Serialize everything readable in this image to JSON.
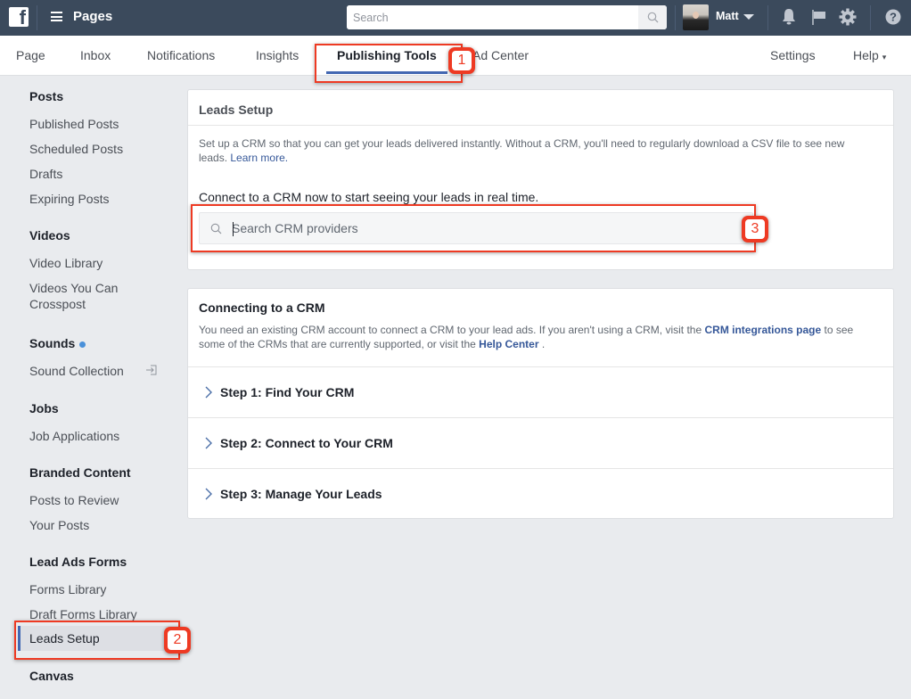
{
  "topbar": {
    "brand_icon": "facebook-logo",
    "menu_icon": "hamburger-icon",
    "app_title": "Pages",
    "search_placeholder": "Search",
    "search_icon": "search-icon",
    "user_name": "Matt",
    "icons": [
      "bell-icon",
      "flag-icon",
      "gear-icon",
      "help-icon"
    ]
  },
  "nav": {
    "tabs": [
      {
        "label": "Page"
      },
      {
        "label": "Inbox"
      },
      {
        "label": "Notifications"
      },
      {
        "label": "Insights"
      },
      {
        "label": "Publishing Tools",
        "active": true
      },
      {
        "label": "Ad Center"
      }
    ],
    "settings_label": "Settings",
    "help_label": "Help",
    "help_caret": "▾"
  },
  "sidebar": {
    "sections": [
      {
        "heading": "Posts",
        "items": [
          "Published Posts",
          "Scheduled Posts",
          "Drafts",
          "Expiring Posts"
        ]
      },
      {
        "heading": "Videos",
        "items": [
          "Video Library",
          "Videos You Can Crosspost"
        ]
      },
      {
        "heading": "Sounds",
        "items": [
          "Sound Collection"
        ],
        "has_dot": true
      },
      {
        "heading": "Jobs",
        "items": [
          "Job Applications"
        ]
      },
      {
        "heading": "Branded Content",
        "items": [
          "Posts to Review",
          "Your Posts"
        ]
      },
      {
        "heading": "Lead Ads Forms",
        "items": [
          "Forms Library",
          "Draft Forms Library",
          "Leads Setup"
        ],
        "active_item": "Leads Setup"
      },
      {
        "heading": "Canvas",
        "items": []
      }
    ],
    "videos_item2_line1": "Videos You Can",
    "videos_item2_line2": "Crosspost"
  },
  "leads_setup_card": {
    "title": "Leads Setup",
    "description": "Set up a CRM so that you can get your leads delivered instantly. Without a CRM, you'll need to regularly download a CSV file to see new leads.",
    "learn_more": "Learn more.",
    "connect_text": "Connect to a CRM now to start seeing your leads in real time.",
    "crm_search_placeholder": "Search CRM providers",
    "crm_search_value": ""
  },
  "connecting_card": {
    "title": "Connecting to a CRM",
    "desc_part1": "You need an existing CRM account to connect a CRM to your lead ads. If you aren't using a CRM, visit the",
    "crm_link": "CRM integrations page",
    "desc_part2": "to see some of the CRMs that are currently supported, or visit the",
    "help_link": "Help Center",
    "desc_part3": ".",
    "steps": [
      {
        "label": "Step 1: Find Your CRM"
      },
      {
        "label": "Step 2: Connect to Your CRM"
      },
      {
        "label": "Step 3: Manage Your Leads"
      }
    ]
  },
  "annotations": {
    "badges": [
      "1",
      "2",
      "3"
    ],
    "color": "#ee3a23"
  },
  "colors": {
    "topbar_bg": "#3b4a5c",
    "accent_blue": "#4267b2",
    "link_blue": "#365899",
    "page_bg": "#e9ebee"
  }
}
